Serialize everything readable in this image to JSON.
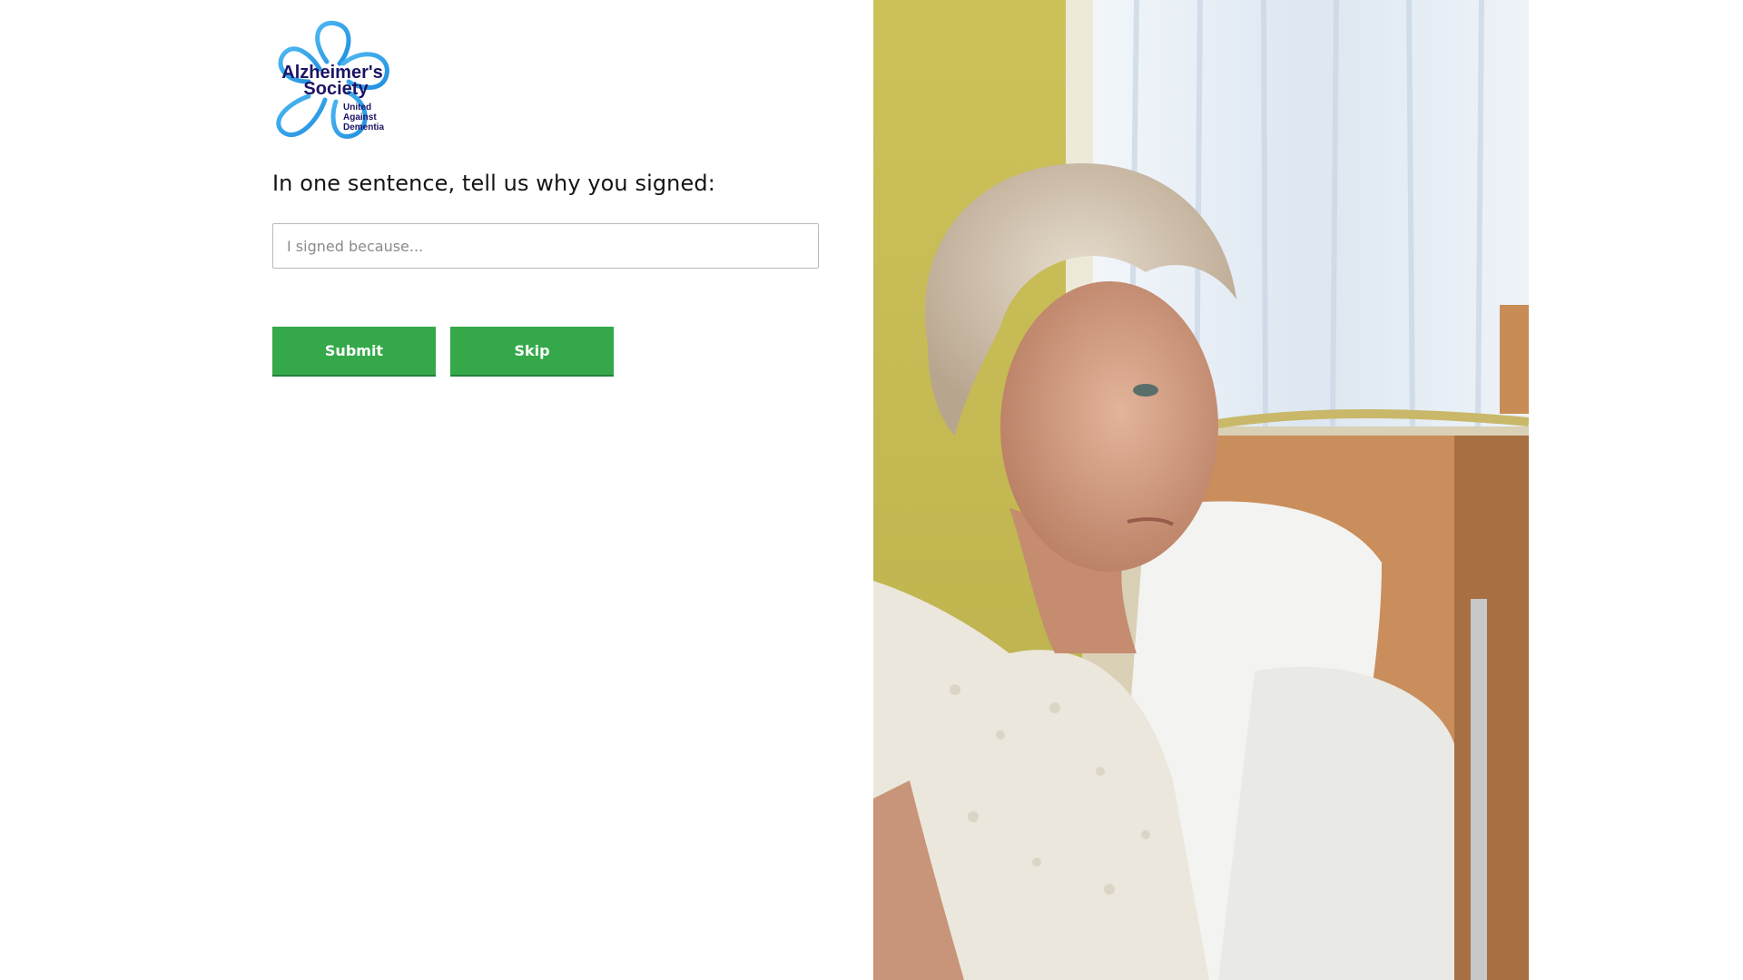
{
  "logo": {
    "name_line1": "Alzheimer's",
    "name_line2": "Society",
    "tagline_line1": "United",
    "tagline_line2": "Against",
    "tagline_line3": "Dementia",
    "flower_color": "#2aa0e8",
    "text_color": "#1b1464"
  },
  "form": {
    "question": "In one sentence, tell us why you signed:",
    "input_placeholder": "I signed because...",
    "input_value": "",
    "submit_label": "Submit",
    "skip_label": "Skip"
  },
  "colors": {
    "button_green": "#35a84a",
    "background": "#ffffff"
  },
  "photo": {
    "icon": "elderly-woman-photo"
  }
}
